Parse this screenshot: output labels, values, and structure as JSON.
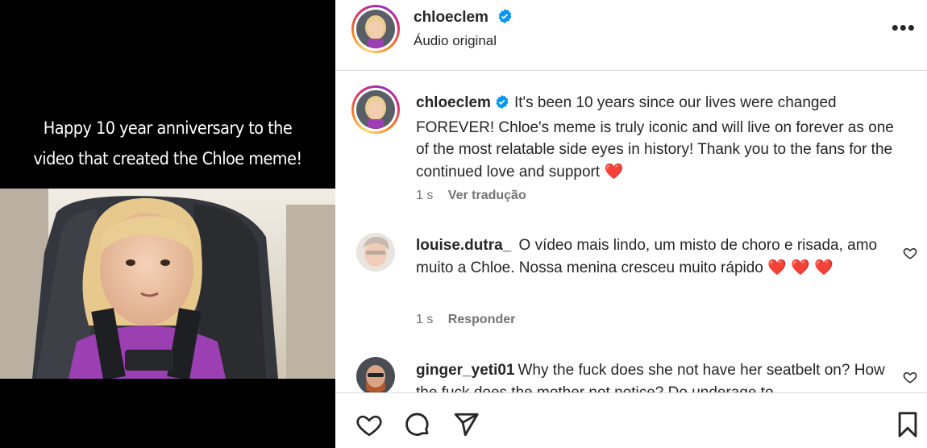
{
  "media": {
    "caption_line1": "Happy 10 year anniversary to the",
    "caption_line2": "video that created the Chloe meme!"
  },
  "header": {
    "username": "chloeclem",
    "audio_label": "Áudio original",
    "more_label": "•••"
  },
  "post": {
    "username": "chloeclem",
    "caption": "It's been 10 years since our lives were changed FOREVER! Chloe's meme is truly iconic and will live on forever as one of the most relatable side eyes in history! Thank you to the fans for the continued love and support",
    "emoji": "❤️",
    "time": "1 s",
    "translate_label": "Ver tradução"
  },
  "comments": [
    {
      "username": "louise.dutra_",
      "text": "O vídeo mais lindo, um misto de choro e risada, amo muito a Chloe. Nossa menina cresceu muito rápido",
      "emoji": "❤️ ❤️ ❤️",
      "time": "1 s",
      "reply_label": "Responder"
    },
    {
      "username": "ginger_yeti01",
      "text": "Why the fuck does she not have her seatbelt on?",
      "overflow_text": "How the fuck does the mother not notice? Do underage to"
    }
  ],
  "colors": {
    "text": "#262626",
    "muted": "#737373",
    "verified": "#0095f6",
    "heart": "#ed4956"
  }
}
